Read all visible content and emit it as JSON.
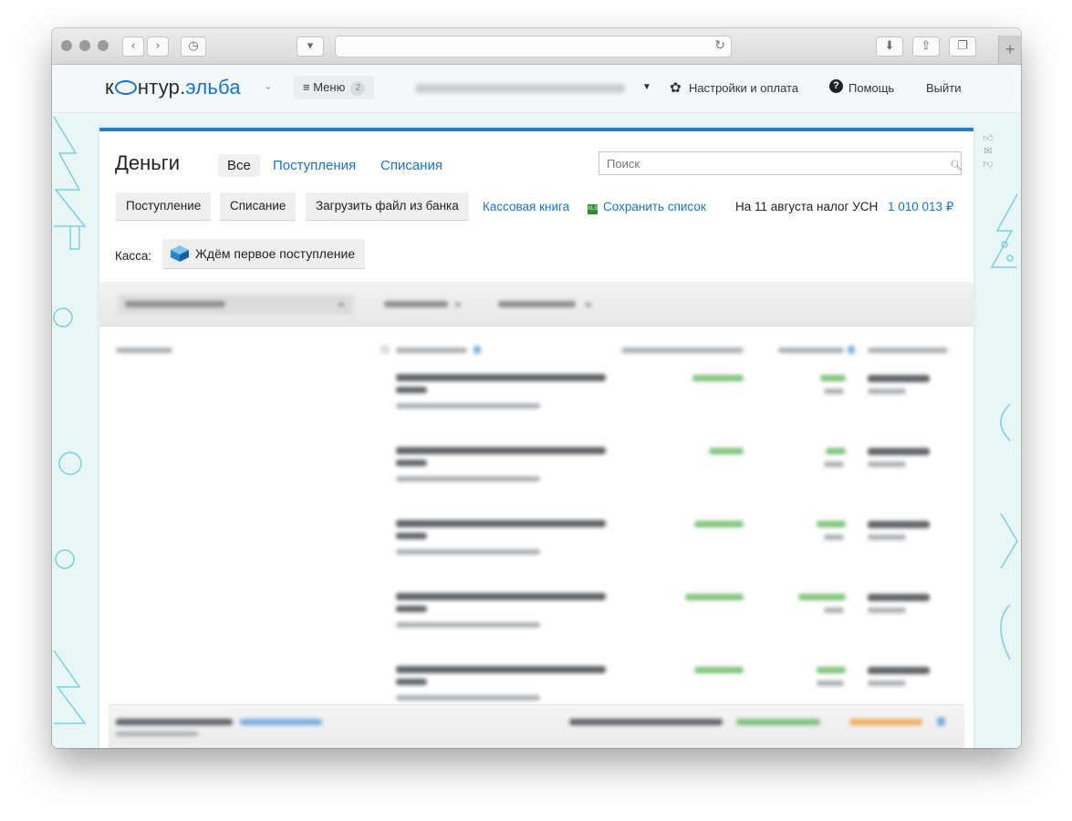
{
  "header": {
    "logo_part1": "к",
    "logo_part2": "нтур.",
    "logo_part3": "эльба",
    "menu_label": "≡ Меню",
    "menu_badge": "2",
    "settings_label": "Настройки и оплата",
    "help_label": "Помощь",
    "logout_label": "Выйти"
  },
  "page": {
    "title": "Деньги",
    "tabs": [
      "Все",
      "Поступления",
      "Списания"
    ],
    "active_tab": 0,
    "search_placeholder": "Поиск"
  },
  "actions": {
    "income_button": "Поступление",
    "expense_button": "Списание",
    "upload_button": "Загрузить файл из банка",
    "cash_book_link": "Кассовая книга",
    "save_list_link": "Сохранить список",
    "xls_badge": "XLS",
    "tax_text": "На 11 августа налог УСН",
    "tax_amount": "1 010 013 ₽"
  },
  "kassa": {
    "label": "Касса:",
    "status": "Ждём первое поступление"
  },
  "colors": {
    "accent_blue": "#1b73c4",
    "top_border": "#1b80d0",
    "income_green": "#7ec27a",
    "expense_orange": "#f0b060",
    "page_background": "#e8f6f8"
  },
  "table": {
    "row_count": 5
  }
}
